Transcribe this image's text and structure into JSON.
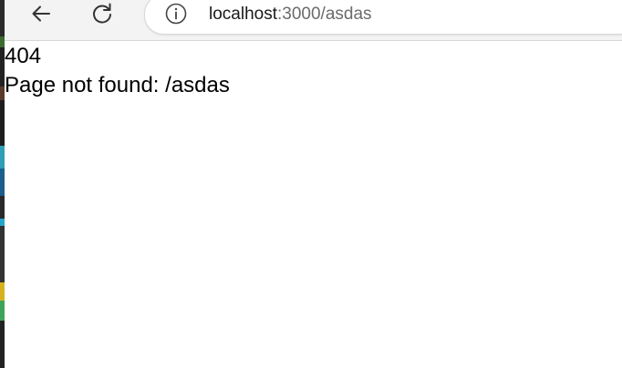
{
  "browser": {
    "address_bar": {
      "host": "localhost",
      "path": ":3000/asdas"
    },
    "icons": {
      "back": "back-arrow-icon",
      "reload": "reload-icon",
      "site_info": "info-icon"
    }
  },
  "page": {
    "status_code": "404",
    "message": "Page not found: /asdas"
  }
}
